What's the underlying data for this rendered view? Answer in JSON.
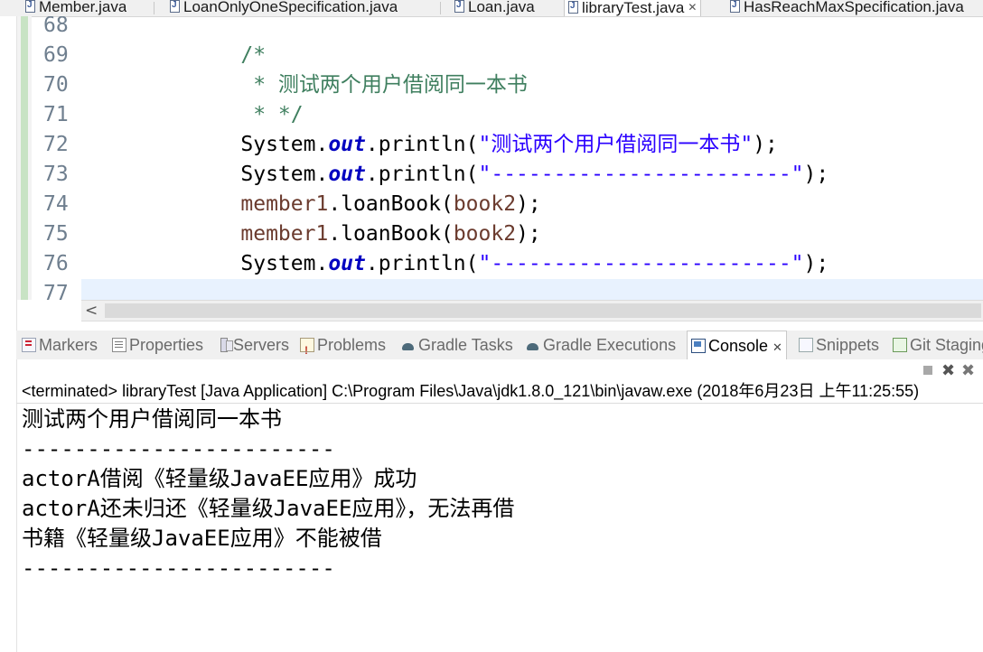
{
  "editor_tabs": [
    {
      "label": "Member.java"
    },
    {
      "label": "LoanOnlyOneSpecification.java"
    },
    {
      "label": "Loan.java"
    },
    {
      "label": "libraryTest.java",
      "active": true,
      "close": "✕"
    },
    {
      "label": "HasReachMaxSpecification.java"
    }
  ],
  "code_lines": [
    {
      "num": "68",
      "text": "/*"
    },
    {
      "num": "69",
      "text": " * 测试两个用户借阅同一本书"
    },
    {
      "num": "70",
      "text": " * */"
    },
    {
      "num": "71",
      "pre": "System.",
      "field": "out",
      "mid": ".println(",
      "str": "\"测试两个用户借阅同一本书\"",
      "post": ");"
    },
    {
      "num": "72",
      "pre": "System.",
      "field": "out",
      "mid": ".println(",
      "str": "\"------------------------\"",
      "post": ");"
    },
    {
      "num": "73",
      "var": "member1",
      "method": ".loanBook(",
      "arg": "book2",
      "post": ");"
    },
    {
      "num": "74",
      "var": "member1",
      "method": ".loanBook(",
      "arg": "book2",
      "post": ");"
    },
    {
      "num": "75",
      "pre": "System.",
      "field": "out",
      "mid": ".println(",
      "str": "\"------------------------\"",
      "post": ");"
    },
    {
      "num": "76",
      "text": ""
    },
    {
      "num": "77",
      "text": ""
    }
  ],
  "scrollbar": {
    "left_arrow": "<"
  },
  "view_tabs": [
    {
      "label": "Markers",
      "icon": "markers-icon"
    },
    {
      "label": "Properties",
      "icon": "properties-icon"
    },
    {
      "label": "Servers",
      "icon": "servers-icon"
    },
    {
      "label": "Problems",
      "icon": "problems-icon"
    },
    {
      "label": "Gradle Tasks",
      "icon": "gradle-icon"
    },
    {
      "label": "Gradle Executions",
      "icon": "gradle-icon"
    },
    {
      "label": "Console",
      "icon": "console-icon",
      "active": true,
      "close": "✕"
    },
    {
      "label": "Snippets",
      "icon": "snippets-icon"
    },
    {
      "label": "Git Staging",
      "icon": "git-icon"
    }
  ],
  "console_toolbar": {
    "remove": "✖",
    "remove_all": "✖"
  },
  "console": {
    "header": "<terminated> libraryTest [Java Application] C:\\Program Files\\Java\\jdk1.8.0_121\\bin\\javaw.exe (2018年6月23日 上午11:25:55)",
    "lines": [
      "测试两个用户借阅同一本书",
      "------------------------",
      "actorA借阅《轻量级JavaEE应用》成功",
      "actorA还未归还《轻量级JavaEE应用》，无法再借",
      "书籍《轻量级JavaEE应用》不能被借",
      "------------------------"
    ]
  }
}
